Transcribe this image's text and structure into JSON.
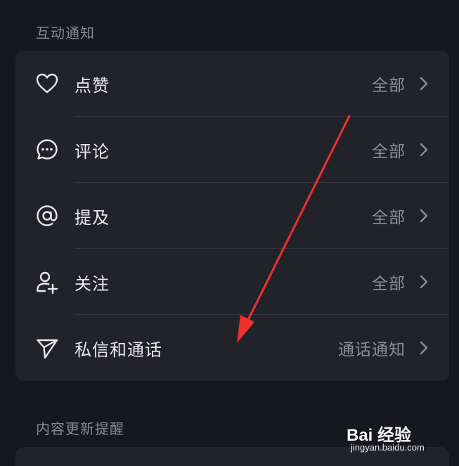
{
  "sections": {
    "interaction": {
      "title": "互动通知",
      "items": [
        {
          "label": "点赞",
          "value": "全部",
          "icon": "heart-icon"
        },
        {
          "label": "评论",
          "value": "全部",
          "icon": "comment-icon"
        },
        {
          "label": "提及",
          "value": "全部",
          "icon": "at-icon"
        },
        {
          "label": "关注",
          "value": "全部",
          "icon": "add-user-icon"
        },
        {
          "label": "私信和通话",
          "value": "通话通知",
          "icon": "send-icon"
        }
      ]
    },
    "content_update": {
      "title": "内容更新提醒"
    }
  },
  "watermark": {
    "logo_text": "Bai 经验",
    "url": "jingyan.baidu.com"
  },
  "colors": {
    "background": "#17171f",
    "card": "#22222b",
    "arrow": "#f0302f"
  }
}
